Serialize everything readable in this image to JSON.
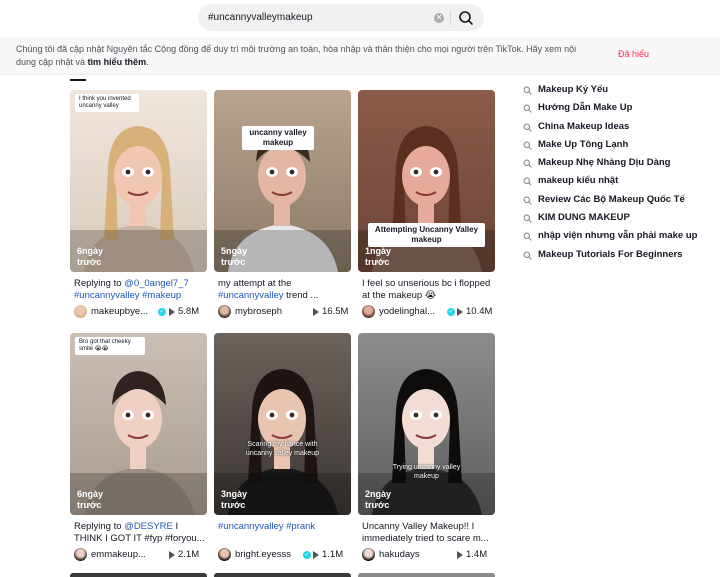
{
  "search": {
    "query": "#uncannyvalleymakeup"
  },
  "notice": {
    "text": "Chúng tôi đã cập nhật Nguyên tắc Cộng đồng để duy trì môi trường an toàn, hòa nhập và thân thiện cho mọi người trên TikTok. Hãy xem nội dung cập nhật và ",
    "link": "tìm hiểu thêm",
    "end": ".",
    "dismiss": "Đã hiểu"
  },
  "videos": [
    {
      "time": "6ngày trước",
      "caption_pre": "Replying to ",
      "caption_tag": "@0_0angel7_7 #uncannyvalley #makeup",
      "caption_post": "",
      "author": "makeupbye...",
      "verified": true,
      "views": "5.8M",
      "reply": "I think you invented uncanny valley"
    },
    {
      "time": "5ngày trước",
      "caption_pre": "my attempt at the ",
      "caption_tag": "#uncannyvalley",
      "caption_post": " trend ...",
      "author": "mybroseph",
      "verified": false,
      "views": "16.5M",
      "overlay": "uncanny valley makeup"
    },
    {
      "time": "1ngày trước",
      "caption_pre": "I feel so unserious bc i flopped at the makeup 😭 ",
      "caption_tag": "",
      "caption_post": "",
      "author": "yodelinghal...",
      "verified": true,
      "views": "10.4M",
      "overlay": "Attempting Uncanny Valley makeup"
    },
    {
      "time": "6ngày trước",
      "caption_pre": "Replying to ",
      "caption_tag": "@DESYRE",
      "caption_post": " I THINK I GOT IT #fyp #foryou...",
      "author": "emmakeup...",
      "verified": false,
      "views": "2.1M",
      "reply": "Bro got that cheeky smile 😭😭"
    },
    {
      "time": "3ngày trước",
      "caption_pre": "",
      "caption_tag": "#uncannyvalley #prank",
      "caption_post": "",
      "author": "bright.eyesss",
      "verified": true,
      "views": "1.1M",
      "overlay": "Scaring my fiancé with uncanny valley makeup"
    },
    {
      "time": "2ngày trước",
      "caption_pre": "Uncanny Valley Makeup!! I immediately tried to scare m...",
      "caption_tag": "",
      "caption_post": "",
      "author": "hakudays",
      "verified": false,
      "views": "1.4M",
      "overlay": "Trying uncanny valley makeup"
    }
  ],
  "related_searches": [
    "Makeup Kỷ Yếu",
    "Hướng Dẫn Make Up",
    "China Makeup Ideas",
    "Make Up Tông Lạnh",
    "Makeup Nhẹ Nhàng Dịu Dàng",
    "makeup kiểu nhật",
    "Review Các Bộ Makeup Quốc Tế",
    "KIM DUNG MAKEUP",
    "nhập viện nhưng vẫn phải make up",
    "Makeup Tutorials For Beginners"
  ],
  "colors": {
    "accent": "#fe2c55",
    "hashtag": "#1e57b5",
    "verified": "#20d5ec"
  },
  "icons": {
    "search": "search-icon",
    "clear": "clear-icon",
    "play": "play-icon",
    "verified": "verified-icon"
  }
}
